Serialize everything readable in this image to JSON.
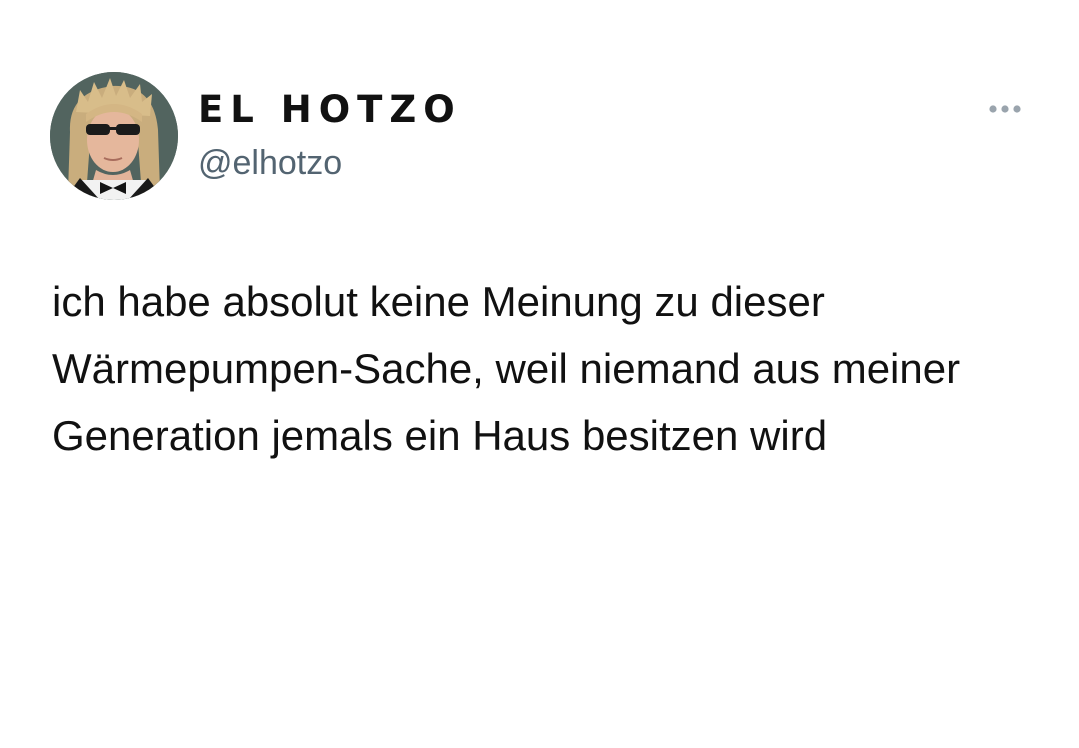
{
  "tweet": {
    "author": {
      "display_name": "EL HOTZO",
      "handle": "@elhotzo",
      "avatar": "profile-photo"
    },
    "more_icon": "more-horizontal-icon",
    "text": "ich habe absolut keine Meinung zu dieser Wärmepumpen-Sache, weil niemand aus meiner Generation jemals ein Haus besitzen wird"
  }
}
